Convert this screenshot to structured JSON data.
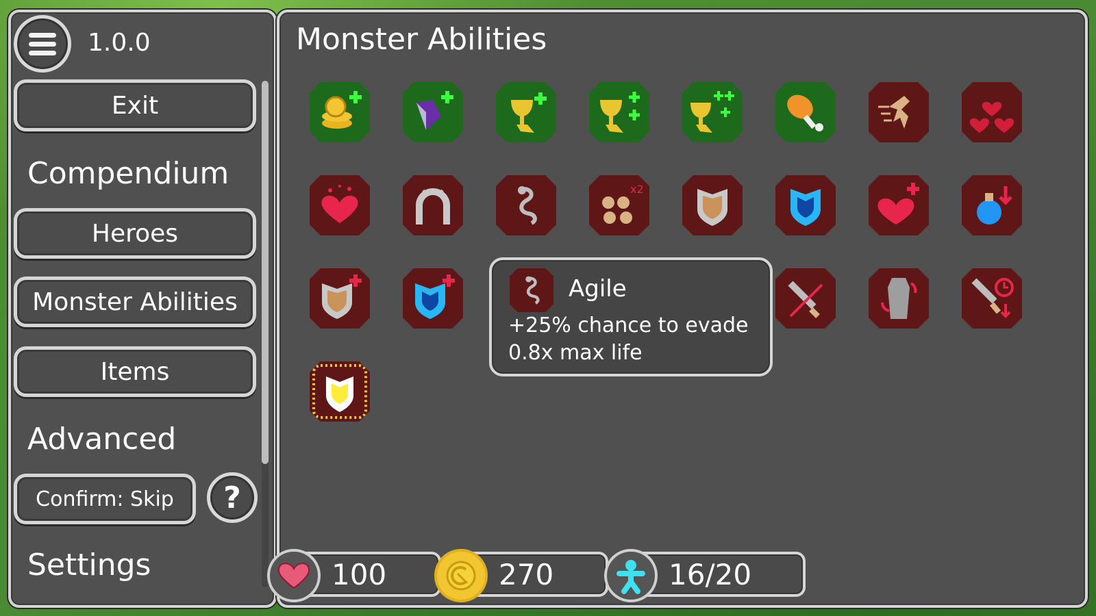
{
  "sidebar": {
    "version": "1.0.0",
    "exit_label": "Exit",
    "compendium_title": "Compendium",
    "heroes_label": "Heroes",
    "monster_abilities_label": "Monster Abilities",
    "items_label": "Items",
    "advanced_title": "Advanced",
    "confirm_label": "Confirm: Skip",
    "help_label": "?",
    "settings_title": "Settings"
  },
  "main": {
    "title": "Monster Abilities"
  },
  "tooltip": {
    "title": "Agile",
    "line1": "+25% chance to evade",
    "line2": "0.8x max life"
  },
  "stats": {
    "life": "100",
    "gold": "270",
    "heroes": "16/20"
  },
  "colors": {
    "panel": "#505050",
    "green_icon": "#1d6a1d",
    "red_icon": "#5e1616",
    "border": "#d6d6d6"
  },
  "icons": [
    "gold-coins-plus-icon",
    "purple-gem-plus-icon",
    "golden-chalice-plus-icon",
    "golden-chalice-double-plus-icon",
    "golden-chalice-triple-plus-icon",
    "drumstick-icon",
    "dashing-figure-icon",
    "triple-hearts-icon",
    "sparkling-heart-icon",
    "horseshoe-icon",
    "snake-icon",
    "swarm-x2-icon",
    "wooden-shield-icon",
    "blue-shield-icon",
    "heart-plus-icon",
    "blue-potion-down-icon",
    "wooden-shield-plus-icon",
    "blue-shield-plus-icon",
    "sword-slash-crossed-icon",
    "coffin-revive-icon",
    "sword-clock-icon",
    "radiant-yellow-shield-icon"
  ]
}
